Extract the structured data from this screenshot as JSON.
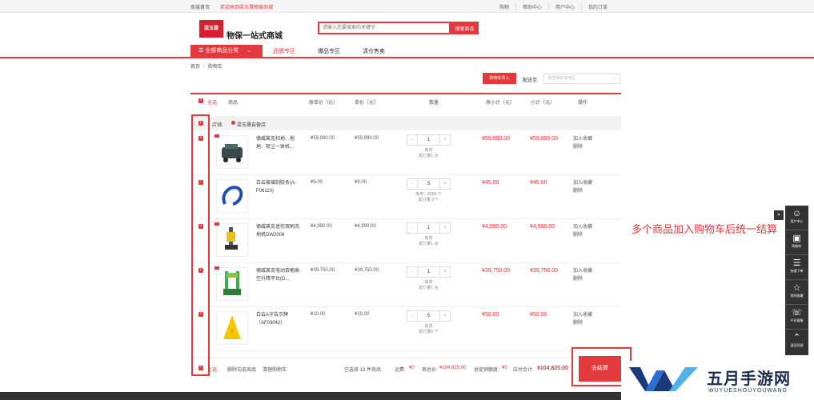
{
  "topbar": {
    "home": "商城首页",
    "welcome": "欢迎来到梁玉晟物保商城",
    "links": [
      "购物",
      "帮助中心",
      "用户中心",
      "我的订单"
    ]
  },
  "header": {
    "logo": "梁玉晟",
    "slogan": "物保一站式商城",
    "search_placeholder": "请输入您要搜索的关键字",
    "search_button": "搜索商品"
  },
  "nav": {
    "all_categories": "全部商品分类",
    "items": [
      "品牌专区",
      "爆品专区",
      "清仓售卖"
    ]
  },
  "breadcrumb": {
    "home": "首页",
    "sep": "/",
    "current": "购物车"
  },
  "tools": {
    "import_button": "购物车导入",
    "ship_label": "配送至:",
    "ship_placeholder": "请选择收货地区"
  },
  "table_header": {
    "select_all": "全选",
    "columns": [
      "商品",
      "原单价（元）",
      "单价（元）",
      "数量",
      "原小计（元）",
      "小计（元）",
      "操作"
    ]
  },
  "store": {
    "label": "店铺:",
    "name": "梁玉晟自营店"
  },
  "items": [
    {
      "name": "德威莱克扫地、拖地、吸尘一体机...",
      "orig_price": "¥59,990.00",
      "price": "¥59,990.00",
      "qty": "1",
      "stock": "有货",
      "min": "起订量1 台",
      "orig_subtotal": "¥59,990.00",
      "subtotal": "¥59,990.00",
      "op1": "加入收藏",
      "op2": "删除"
    },
    {
      "name": "白云玻璃刮胶条(A-F06110)",
      "orig_price": "¥9.00",
      "price": "¥9.00",
      "qty": "5",
      "stock": "库存：6550 个",
      "min": "起订量 3 个",
      "orig_subtotal": "¥45.00",
      "subtotal": "¥45.00",
      "op1": "加入收藏",
      "op2": "删除"
    },
    {
      "name": "德威莱克迷你双刷洗地机DW2008",
      "orig_price": "¥4,990.00",
      "price": "¥4,990.00",
      "qty": "1",
      "stock": "有货",
      "min": "起订量1 台",
      "orig_subtotal": "¥4,990.00",
      "subtotal": "¥4,990.00",
      "op1": "加入收藏",
      "op2": "删除"
    },
    {
      "name": "德威莱克电动双桅高空升降平台(D...",
      "orig_price": "¥39,750.00",
      "price": "¥39,750.00",
      "qty": "1",
      "stock": "有货",
      "min": "起订量1 台",
      "orig_subtotal": "¥39,750.00",
      "subtotal": "¥39,750.00",
      "op1": "加入收藏",
      "op2": "删除"
    },
    {
      "name": "白云A字告示牌（AF03042）",
      "orig_price": "¥10.00",
      "price": "¥10.00",
      "qty": "5",
      "stock": "有货",
      "min": "起订量5 个",
      "orig_subtotal": "¥50.00",
      "subtotal": "¥50.00",
      "op1": "加入收藏",
      "op2": "删除"
    }
  ],
  "footer": {
    "select_all": "全选",
    "delete_selected": "删除勾选商品",
    "clear_cart": "清理购物车",
    "selected_count": "已选择 13 件商品",
    "shipping_label": "运费:",
    "shipping": "¥0",
    "orig_total_label": "商总价:",
    "orig_total": "¥104,825.00",
    "discount_label": "总促销额度:",
    "discount": "¥0",
    "total_label": "应付合计:",
    "total": "¥104,825.00",
    "checkout": "去结算"
  },
  "annotation": "多个商品加入购物车后统一结算",
  "sidebar": {
    "collapse": "»",
    "items": [
      {
        "icon": "user-icon",
        "label": "用户中心"
      },
      {
        "icon": "cart-icon",
        "label": "购物车"
      },
      {
        "icon": "quick-order-icon",
        "label": "快速下单"
      },
      {
        "icon": "star-icon",
        "label": "我的收藏"
      },
      {
        "icon": "headset-icon",
        "label": "平台客服"
      },
      {
        "icon": "arrow-up-icon",
        "label": "返回顶部"
      }
    ]
  },
  "watermark": {
    "title": "五月手游网",
    "subtitle": "WUYUESHOUYOUWANG"
  },
  "colors": {
    "accent": "#e4393c",
    "sidebar": "#333333",
    "watermark": "#1e2d4d"
  }
}
